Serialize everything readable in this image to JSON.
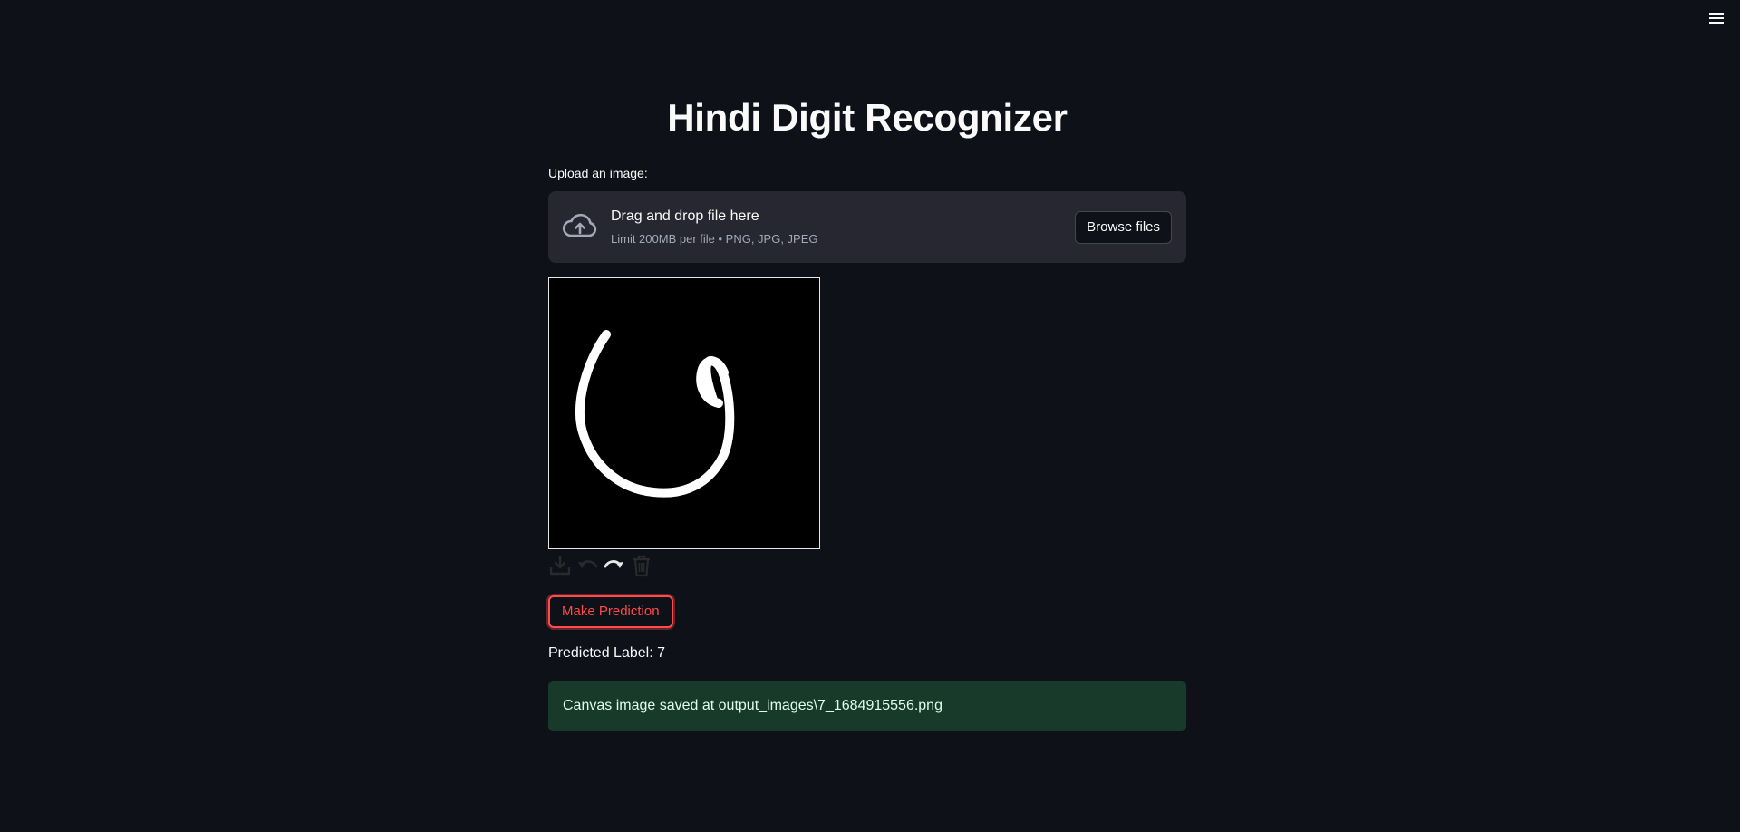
{
  "header": {
    "menu_icon": "hamburger-menu-icon"
  },
  "main": {
    "title": "Hindi Digit Recognizer",
    "uploader": {
      "label": "Upload an image:",
      "drop_title": "Drag and drop file here",
      "drop_limits": "Limit 200MB per file • PNG, JPG, JPEG",
      "browse_label": "Browse files",
      "icon": "cloud-upload-icon"
    },
    "canvas": {
      "background": "#000000",
      "stroke_color": "#ffffff",
      "toolbar": [
        "download-icon",
        "undo-icon",
        "redo-icon",
        "trash-icon"
      ]
    },
    "predict_button": "Make Prediction",
    "predicted_label": "Predicted Label: 7",
    "success_message": "Canvas image saved at output_images\\7_1684915556.png"
  },
  "colors": {
    "background": "#0e1117",
    "accent": "#ff4b4b",
    "panel": "#262730",
    "success_bg": "#183a2a"
  }
}
